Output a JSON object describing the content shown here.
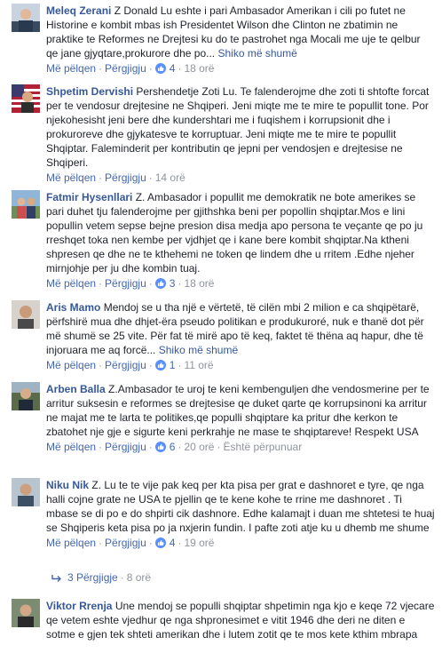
{
  "labels": {
    "like": "Më pëlqen",
    "reply": "Përgjigju",
    "see_more": "Shiko më shumë",
    "edited": "Është përpunuar",
    "dot": "·"
  },
  "comments": [
    {
      "author": "Meleq Zerani",
      "text": "Z Donald Lu eshte i pari Ambasador Amerikan i cili po futet ne Historine e kombit mbas ish Presidentet Wilson dhe Clinton ne zbatimin ne praktike te Reformes ne Drejtesi ku do te pastrohet nga Mocali me uje te qelbur qe jane gjyqtare,prokurore dhe po...",
      "likes": "4",
      "time": "18 orë"
    },
    {
      "author": "Shpetim Dervishi",
      "text": "Pershendetje Zoti Lu. Te falenderojme dhe zoti ti shtofte forcat per te vendosur drejtesine ne Shqiperi. Jeni miqte me te mire te popullit tone. Por njekohesisht jeni bere dhe kundershtari me i fuqishem i korrupsionit dhe i prokuroreve dhe gjykatesve te korruptuar. Jeni miqte me te mire te popullit Shqiptar. Faleminderit per kontributin qe jepni per vendosjen e drejtesise ne Shqiperi.",
      "time": "14 orë"
    },
    {
      "author": "Fatmir Hysenllari",
      "text": "Z. Ambasador i popullit me demokratik ne bote amerikes se pari duhet tju falenderojme per gjithshka beni per popollin shqiptar.Mos e lini popullin vetem sepse bejne presion disa medja apo persona te veçante qe po ju rreshqet toka nen kembe per vjdhjet qe i kane bere kombit shqiptar.Na ktheni shpresen qe dhe ne te kthehemi ne token qe lindem dhe u rritem .Edhe njeher mirnjohje per ju dhe kombin tuaj.",
      "likes": "3",
      "time": "18 orë"
    },
    {
      "author": "Aris Mamo",
      "text": "Mendoj se u tha një e vërtetë, të cilën mbi 2 milion e ca shqipëtarë, përfshirë mua dhe dhjet-ëra pseudo politikan e produkuroré, nuk e thanë dot për më shumë se 25 vite. Për fat të mirë apo të keq, faktet të thëna aq hapur, dhe të injoruara me aq forcë...",
      "likes": "1",
      "time": "11 orë"
    },
    {
      "author": "Arben Balla",
      "text": "Z.Ambasador te uroj te keni kembenguljen dhe vendosmerine per te arritur suksesin e reformes se drejtesise qe duket qarte qe korrupsinoni ka arritur ne majat me te larta te politikes,qe populli shqiptare ka pritur dhe kerkon te zbatohet nje gje e sigurte keni perkrahje ne mase te shqiptareve! Respekt USA",
      "likes": "6",
      "time": "20 orë"
    },
    {
      "author": "Niku Nik",
      "text": "Z. Lu te te vije pak keq per kta pisa per grat e dashnoret e tyre, qe nga halli cojne grate ne USA te pjellin qe te kene kohe te rrine me dashnoret . Ti mbase se di po e do shpirti cik dashnore. Edhe kalamajt i duan me shtetesi te huaj se Shqiperis keta pisa po ja nxjerin fundin. I pafte zoti atje ku u dhemb me shume",
      "likes": "4",
      "time": "19 orë"
    },
    {
      "author": "Viktor Rrenja",
      "text": "Une mendoj se populli shqiptar shpetimin nga kjo e keqe 72 vjecare qe vetem eshte vjedhur qe nga shpronesimet e vitit 1946 dhe deri ne diten e sotme e gjen tek shteti amerikan dhe i lutem zotit qe te mos kete kthim mbrapa"
    }
  ],
  "replies": {
    "label": "3 Përgjigje",
    "time": "8 orë"
  },
  "colors": {
    "name": "#365899",
    "link": "#4267b2",
    "meta": "#90949c",
    "text": "#1d2129",
    "like_badge": "#5890ff"
  }
}
